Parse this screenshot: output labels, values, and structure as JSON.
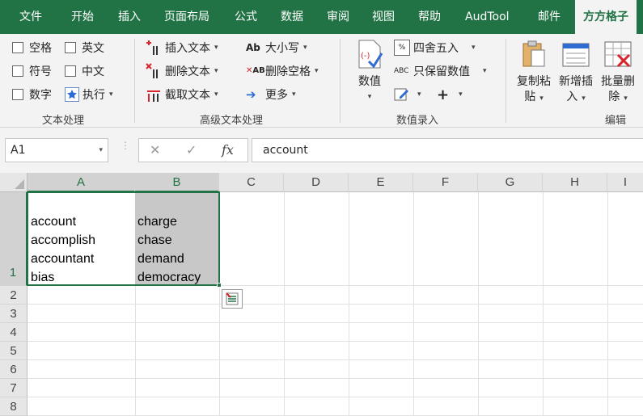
{
  "tabs": [
    "文件",
    "开始",
    "插入",
    "页面布局",
    "公式",
    "数据",
    "审阅",
    "视图",
    "帮助",
    "AudTool",
    "邮件",
    "方方格子"
  ],
  "ribbon": {
    "text_group": {
      "items": [
        "空格",
        "英文",
        "符号",
        "中文",
        "数字",
        "执行"
      ],
      "label": "文本处理"
    },
    "advanced_group": {
      "items": [
        "插入文本",
        "删除文本",
        "截取文本",
        "大小写",
        "删除空格",
        "更多"
      ],
      "label": "高级文本处理"
    },
    "numeric_group": {
      "big_button": "数值",
      "items": [
        "四舍五入",
        "只保留数值"
      ],
      "label": "数值录入"
    },
    "edit_group": {
      "buttons": [
        {
          "line1": "复制粘",
          "line2": "贴"
        },
        {
          "line1": "新增插",
          "line2": "入"
        },
        {
          "line1": "批量删",
          "line2": "除"
        }
      ],
      "label": "编辑"
    }
  },
  "formula_bar": {
    "name_box": "A1",
    "cancel": "✕",
    "enter": "✓",
    "fx": "fx",
    "content": "account"
  },
  "grid": {
    "columns": [
      "A",
      "B",
      "C",
      "D",
      "E",
      "F",
      "G",
      "H",
      "I"
    ],
    "rows": [
      "1",
      "2",
      "3",
      "4",
      "5",
      "6",
      "7",
      "8"
    ],
    "cells": {
      "A1": [
        "account",
        "accomplish",
        "accountant",
        "bias"
      ],
      "B1": [
        "charge",
        "chase",
        "demand",
        "democracy"
      ]
    }
  },
  "colors": {
    "accent": "#217346",
    "ribbon_bg": "#f3f3f3",
    "selected_cell_bg": "#c8c8c8"
  }
}
